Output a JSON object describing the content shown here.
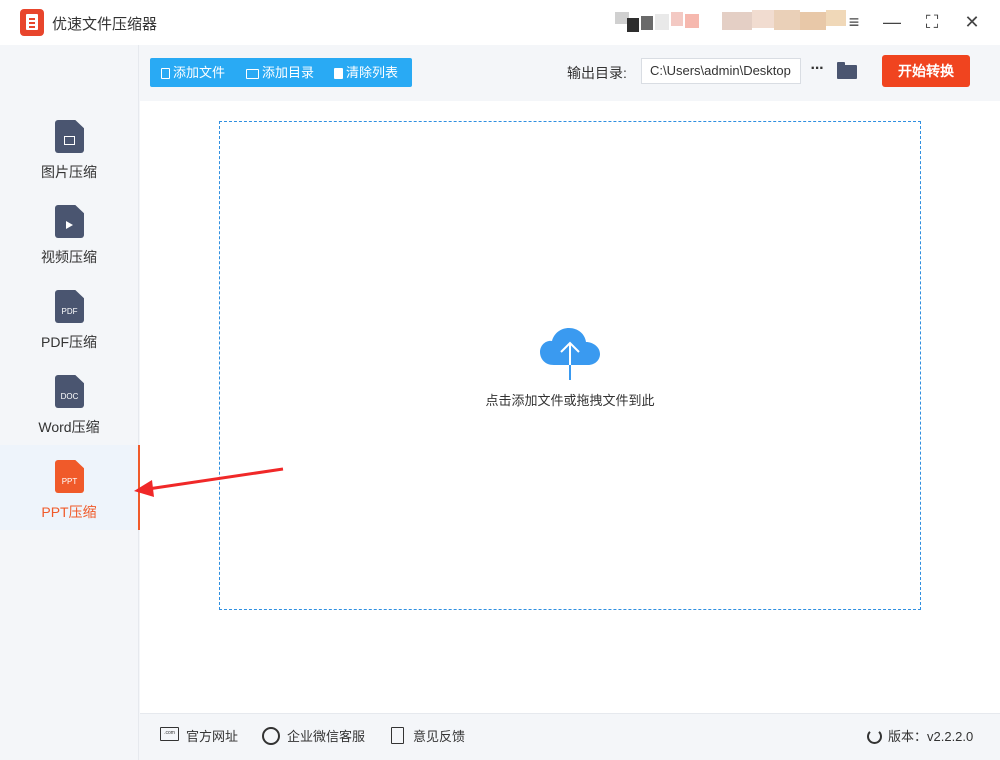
{
  "window": {
    "title": "优速文件压缩器",
    "minimize_glyph": "—",
    "maximize_glyph": "⛶",
    "close_glyph": "✕",
    "menu_glyph": "≡"
  },
  "sidebar": {
    "items": [
      {
        "label": "图片压缩",
        "icon": "image-file-icon",
        "glyph": ""
      },
      {
        "label": "视频压缩",
        "icon": "video-file-icon",
        "glyph": ""
      },
      {
        "label": "PDF压缩",
        "icon": "pdf-file-icon",
        "glyph": "PDF"
      },
      {
        "label": "Word压缩",
        "icon": "doc-file-icon",
        "glyph": "DOC"
      },
      {
        "label": "PPT压缩",
        "icon": "ppt-file-icon",
        "glyph": "PPT",
        "active": true
      }
    ]
  },
  "toolbar": {
    "add_file": "添加文件",
    "add_folder": "添加目录",
    "clear_list": "清除列表",
    "output_label": "输出目录:",
    "output_path": "C:\\Users\\admin\\Desktop",
    "more": "···",
    "start": "开始转换"
  },
  "dropzone": {
    "hint": "点击添加文件或拖拽文件到此"
  },
  "footer": {
    "website": "官方网址",
    "wechat": "企业微信客服",
    "feedback": "意见反馈",
    "version": "版本：v2.2.2.0",
    "com_badge": ".com"
  },
  "colors": {
    "accent_blue": "#29aaf4",
    "accent_orange": "#f0441f",
    "icon_dark": "#4a5570"
  }
}
